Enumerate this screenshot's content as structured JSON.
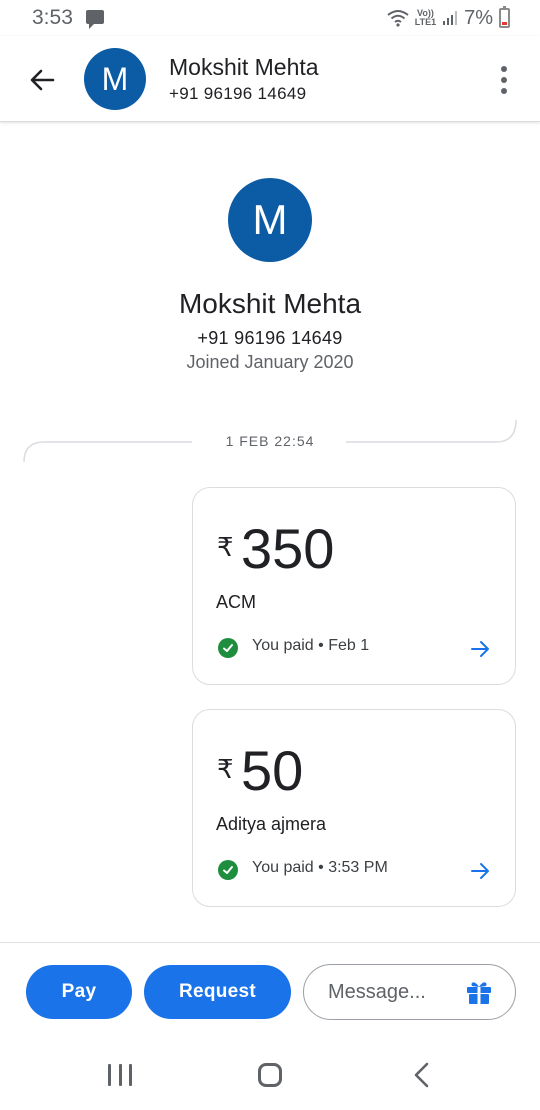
{
  "status_bar": {
    "time": "3:53",
    "network_top": "Vo))",
    "network_bottom": "LTE1",
    "battery": "7%"
  },
  "header": {
    "avatar_initial": "M",
    "name": "Mokshit Mehta",
    "phone": "+91 96196 14649"
  },
  "profile": {
    "avatar_initial": "M",
    "name": "Mokshit Mehta",
    "phone": "+91 96196 14649",
    "joined": "Joined January 2020"
  },
  "date_divider": "1 FEB 22:54",
  "payments": [
    {
      "currency": "₹",
      "amount": "350",
      "note": "ACM",
      "status": "You paid • Feb 1"
    },
    {
      "currency": "₹",
      "amount": "50",
      "note": "Aditya ajmera",
      "status": "You paid • 3:53 PM"
    }
  ],
  "bottom_bar": {
    "pay_label": "Pay",
    "request_label": "Request",
    "message_placeholder": "Message..."
  },
  "colors": {
    "accent": "#1a73e8",
    "avatar": "#0b5ba5",
    "success": "#1e8e3e"
  },
  "icons": {
    "back": "arrow-left-icon",
    "more": "more-vert-icon",
    "paid": "check-circle-icon",
    "details": "arrow-right-icon",
    "gift": "gift-icon"
  }
}
